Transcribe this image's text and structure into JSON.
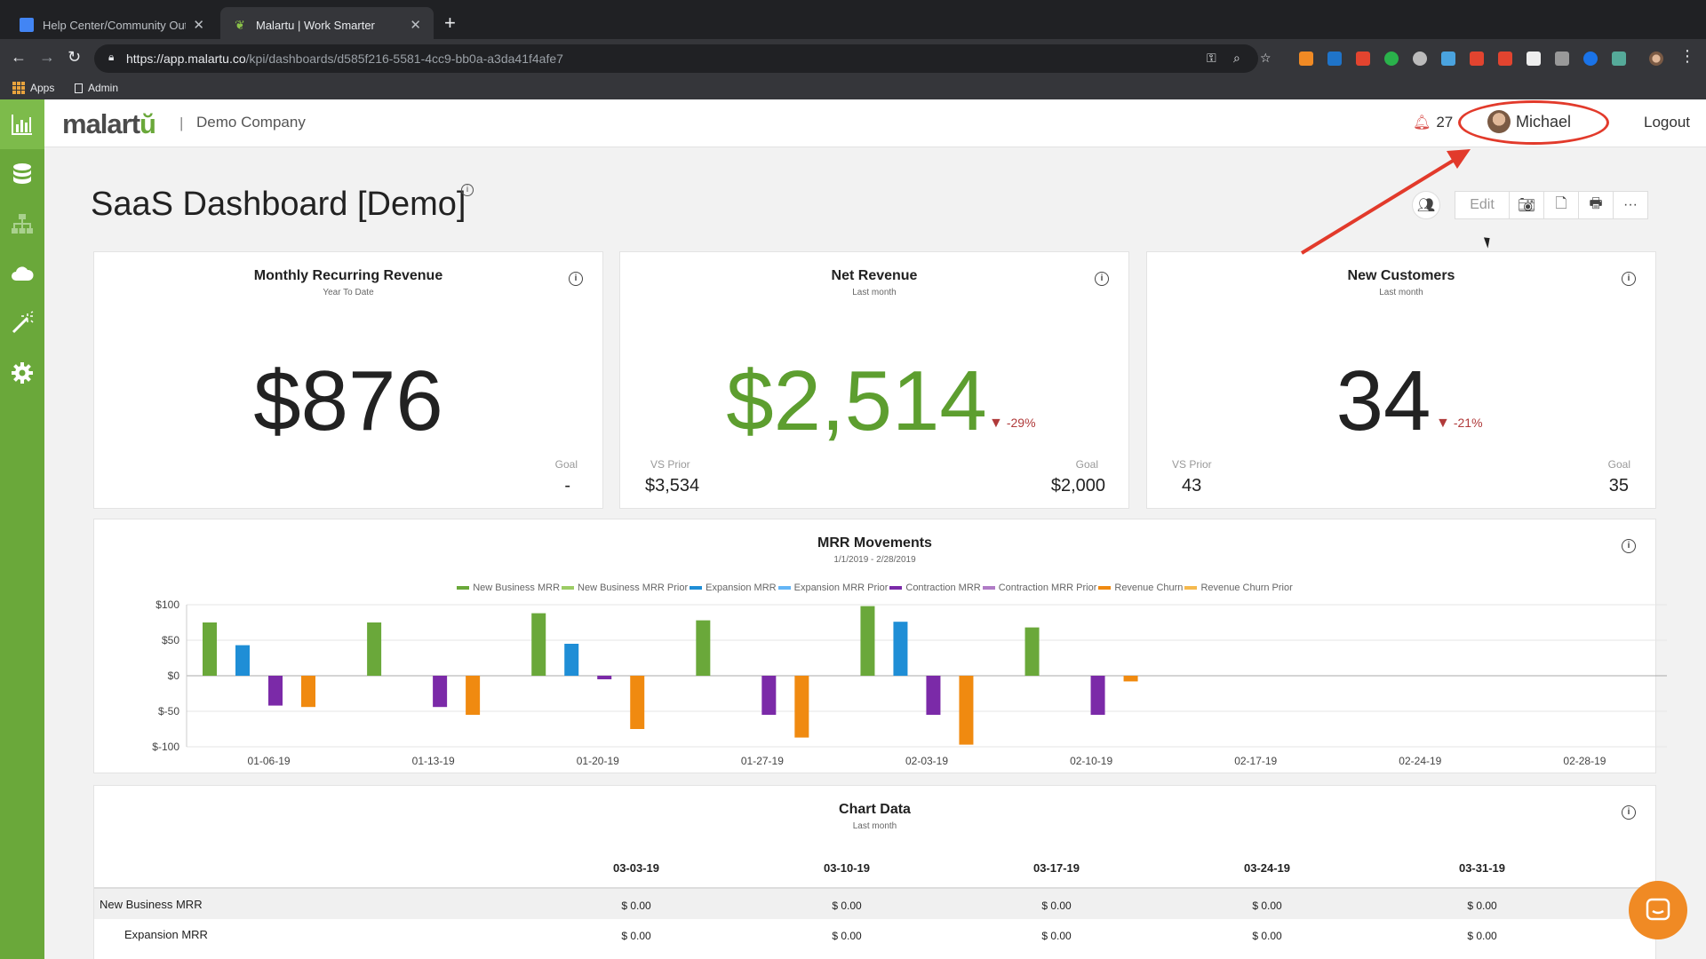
{
  "browser": {
    "tabs": [
      {
        "title": "Help Center/Community Outline",
        "close": "✕"
      },
      {
        "title": "Malartu | Work Smarter",
        "close": "✕"
      }
    ],
    "new_tab": "+",
    "url_host": "https://app.malartu.co",
    "url_path": "/kpi/dashboards/d585f216-5581-4cc9-bb0a-a3da41f4afe7",
    "bookmarks": [
      {
        "label": "Apps"
      },
      {
        "label": "Admin"
      }
    ]
  },
  "app": {
    "logo_text": "malart",
    "logo_accent": "ŭ",
    "company": "Demo Company",
    "notification_count": "27",
    "user_name": "Michael",
    "logout": "Logout",
    "brand_color": "#6aa83a"
  },
  "sidebar": {
    "items": [
      {
        "icon": "bar-chart-icon"
      },
      {
        "icon": "database-icon"
      },
      {
        "icon": "org-chart-icon"
      },
      {
        "icon": "cloud-icon"
      },
      {
        "icon": "magic-wand-icon"
      },
      {
        "icon": "gear-icon"
      }
    ]
  },
  "dashboard": {
    "title": "SaaS Dashboard [Demo]",
    "info_glyph": "i",
    "toolbar": {
      "edit": "Edit",
      "more": "···"
    }
  },
  "kpis": [
    {
      "title": "Monthly Recurring Revenue",
      "subtitle": "Year To Date",
      "value": "$876",
      "goal_label": "Goal",
      "goal_value": "-"
    },
    {
      "title": "Net Revenue",
      "subtitle": "Last month",
      "value": "$2,514",
      "delta": "-29%",
      "prior_label": "VS Prior",
      "prior_value": "$3,534",
      "goal_label": "Goal",
      "goal_value": "$2,000"
    },
    {
      "title": "New Customers",
      "subtitle": "Last month",
      "value": "34",
      "delta": "-21%",
      "prior_label": "VS Prior",
      "prior_value": "43",
      "goal_label": "Goal",
      "goal_value": "35"
    }
  ],
  "chart_data": {
    "type": "bar",
    "title": "MRR Movements",
    "subtitle": "1/1/2019 - 2/28/2019",
    "categories": [
      "01-06-19",
      "01-13-19",
      "01-20-19",
      "01-27-19",
      "02-03-19",
      "02-10-19",
      "02-17-19",
      "02-24-19",
      "02-28-19"
    ],
    "ylim": [
      -100,
      100
    ],
    "yticks": [
      "$100",
      "$50",
      "$0",
      "$-50",
      "$-100"
    ],
    "legend_position": "top-center",
    "series": [
      {
        "name": "New Business MRR",
        "color": "#6aa83a",
        "values": [
          75,
          75,
          88,
          78,
          98,
          68,
          0,
          0,
          0
        ]
      },
      {
        "name": "New Business MRR Prior",
        "color": "#9ccc65",
        "values": [
          0,
          0,
          0,
          0,
          0,
          0,
          0,
          0,
          0
        ]
      },
      {
        "name": "Expansion MRR",
        "color": "#1f8ed6",
        "values": [
          43,
          0,
          45,
          0,
          76,
          0,
          0,
          0,
          0
        ]
      },
      {
        "name": "Expansion MRR Prior",
        "color": "#64b5f6",
        "values": [
          0,
          0,
          0,
          0,
          0,
          0,
          0,
          0,
          0
        ]
      },
      {
        "name": "Contraction MRR",
        "color": "#7b2aa8",
        "values": [
          -42,
          -44,
          -5,
          -55,
          -55,
          -55,
          0,
          0,
          0
        ]
      },
      {
        "name": "Contraction MRR Prior",
        "color": "#b07cc6",
        "values": [
          0,
          0,
          0,
          0,
          0,
          0,
          0,
          0,
          0
        ]
      },
      {
        "name": "Revenue Churn",
        "color": "#f08a10",
        "values": [
          -44,
          -55,
          -75,
          -87,
          -97,
          -8,
          0,
          0,
          0
        ]
      },
      {
        "name": "Revenue Churn Prior",
        "color": "#f5b94e",
        "values": [
          0,
          0,
          0,
          0,
          0,
          0,
          0,
          0,
          0
        ]
      }
    ]
  },
  "table": {
    "title": "Chart Data",
    "subtitle": "Last month",
    "columns": [
      "03-03-19",
      "03-10-19",
      "03-17-19",
      "03-24-19",
      "03-31-19"
    ],
    "rows": [
      {
        "label": "New Business MRR",
        "values": [
          "$ 0.00",
          "$ 0.00",
          "$ 0.00",
          "$ 0.00",
          "$ 0.00"
        ]
      },
      {
        "label": "Expansion MRR",
        "values": [
          "$ 0.00",
          "$ 0.00",
          "$ 0.00",
          "$ 0.00",
          "$ 0.00"
        ]
      }
    ]
  }
}
